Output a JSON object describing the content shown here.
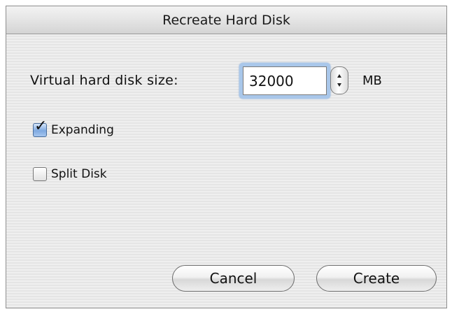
{
  "window": {
    "title": "Recreate Hard Disk"
  },
  "disk_size": {
    "label": "Virtual hard disk size:",
    "value": "32000",
    "unit": "MB"
  },
  "options": {
    "expanding": {
      "label": "Expanding",
      "checked": true
    },
    "split_disk": {
      "label": "Split Disk",
      "checked": false
    }
  },
  "buttons": {
    "cancel_label": "Cancel",
    "create_label": "Create"
  },
  "icons": {
    "checkmark": "checkmark-icon",
    "stepper_up": "chevron-up-icon",
    "stepper_down": "chevron-down-icon"
  },
  "colors": {
    "focus_ring": "#a9c7ea",
    "checkbox_checked": "#7fa9e0"
  }
}
